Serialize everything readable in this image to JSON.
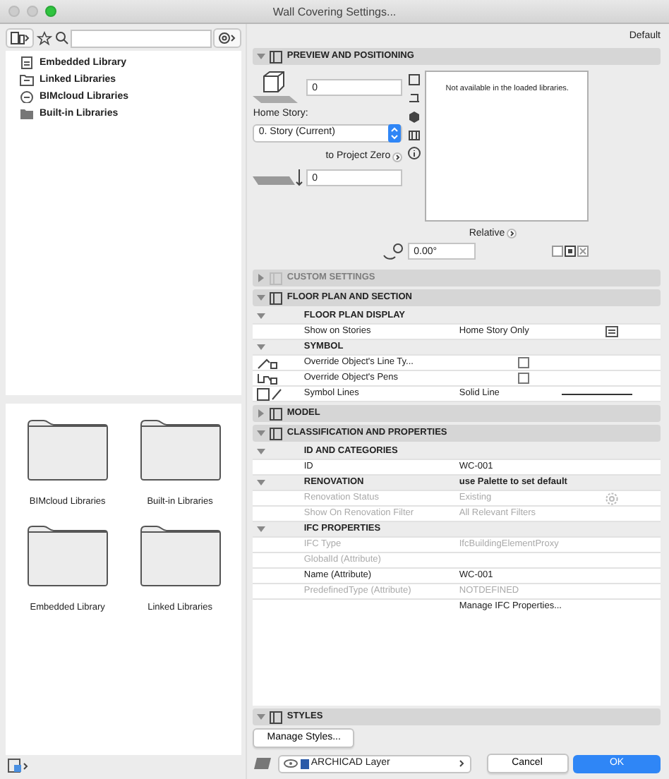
{
  "window": {
    "title": "Wall Covering Settings..."
  },
  "library": {
    "tree": [
      {
        "label": "Embedded Library",
        "kind": "embedded"
      },
      {
        "label": "Linked Libraries",
        "kind": "linked"
      },
      {
        "label": "BIMcloud Libraries",
        "kind": "cloud"
      },
      {
        "label": "Built-in Libraries",
        "kind": "builtin"
      }
    ],
    "folders": [
      {
        "label": "BIMcloud Libraries"
      },
      {
        "label": "Built-in Libraries"
      },
      {
        "label": "Embedded Library"
      },
      {
        "label": "Linked Libraries"
      }
    ]
  },
  "settings": {
    "preset": "Default",
    "preview": {
      "title": "PREVIEW AND POSITIONING",
      "expanded": true,
      "elevation": "0",
      "home_story_label": "Home Story:",
      "home_story": "0. Story (Current)",
      "to_project_zero": "to Project Zero",
      "project_zero_value": "0",
      "message": "Not available in the loaded libraries.",
      "relative": "Relative",
      "angle": "0.00°"
    },
    "sections": [
      {
        "title": "CUSTOM SETTINGS",
        "expanded": false,
        "disabled": true
      },
      {
        "title": "FLOOR PLAN AND SECTION",
        "expanded": true,
        "disabled": false,
        "rows": [
          {
            "kind": "group",
            "label": "FLOOR PLAN DISPLAY",
            "expanded": true
          },
          {
            "kind": "stories",
            "label": "Show on Stories",
            "value": "Home Story Only",
            "dimmed": false
          },
          {
            "kind": "group",
            "label": "SYMBOL",
            "expanded": true
          },
          {
            "kind": "checkbox",
            "label": "Override Object's Line Ty...",
            "dimmed": false,
            "checked": false
          },
          {
            "kind": "checkbox",
            "label": "Override Object's Pens",
            "dimmed": false,
            "checked": false
          },
          {
            "kind": "line",
            "label": "Symbol Lines",
            "value": "Solid Line",
            "dimmed": false
          }
        ]
      },
      {
        "title": "MODEL",
        "expanded": false,
        "disabled": false
      },
      {
        "title": "CLASSIFICATION AND PROPERTIES",
        "expanded": true,
        "disabled": false,
        "rows": [
          {
            "kind": "group",
            "label": "ID AND CATEGORIES",
            "expanded": true
          },
          {
            "kind": "text",
            "label": "ID",
            "value": "WC-001",
            "dimmed": false
          },
          {
            "kind": "group",
            "label": "RENOVATION",
            "value": "use Palette to set default",
            "expanded": true
          },
          {
            "kind": "gear",
            "label": "Renovation Status",
            "value": "Existing",
            "dimmed": true
          },
          {
            "kind": "text",
            "label": "Show On Renovation Filter",
            "value": "All Relevant Filters",
            "dimmed": true
          },
          {
            "kind": "group",
            "label": "IFC PROPERTIES",
            "expanded": true
          },
          {
            "kind": "text",
            "label": "IFC Type",
            "value": "IfcBuildingElementProxy",
            "dimmed": true
          },
          {
            "kind": "text",
            "label": "GlobalId (Attribute)",
            "dimmed": true
          },
          {
            "kind": "text",
            "label": "Name (Attribute)",
            "value": "WC-001",
            "dimmed": false
          },
          {
            "kind": "text",
            "label": "PredefinedType (Attribute)",
            "value": "NOTDEFINED",
            "dimmed": true
          },
          {
            "kind": "text",
            "value": "Manage IFC Properties...",
            "dimmed": false
          }
        ]
      }
    ],
    "styles": {
      "title": "STYLES",
      "expanded": true,
      "button": "Manage Styles..."
    },
    "footer": {
      "layer": "ARCHICAD Layer",
      "cancel": "Cancel",
      "ok": "OK"
    }
  }
}
